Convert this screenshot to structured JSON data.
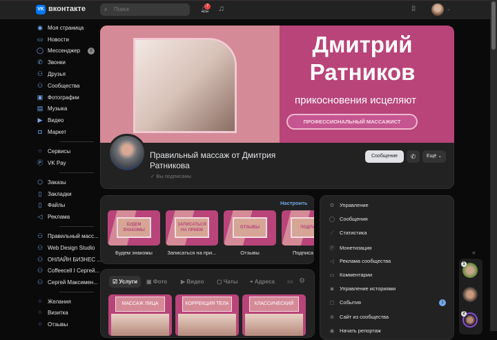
{
  "topbar": {
    "brand": "вконтакте",
    "logo": "VK",
    "search_placeholder": "Поиск",
    "notifications_count": "7"
  },
  "sidebar": {
    "items": [
      {
        "label": "Моя страница",
        "icon": "user-circle-icon"
      },
      {
        "label": "Новости",
        "icon": "news-icon"
      },
      {
        "label": "Мессенджер",
        "icon": "message-icon",
        "badge": "8"
      },
      {
        "label": "Звонки",
        "icon": "phone-icon"
      },
      {
        "label": "Друзья",
        "icon": "friends-icon"
      },
      {
        "label": "Сообщества",
        "icon": "communities-icon"
      },
      {
        "label": "Фотографии",
        "icon": "photo-icon"
      },
      {
        "label": "Музыка",
        "icon": "music-icon"
      },
      {
        "label": "Видео",
        "icon": "video-icon"
      },
      {
        "label": "Маркет",
        "icon": "bag-icon"
      },
      {
        "label": "Сервисы",
        "icon": "services-icon"
      },
      {
        "label": "VK Pay",
        "icon": "vkpay-icon"
      },
      {
        "label": "Заказы",
        "icon": "box-icon"
      },
      {
        "label": "Закладки",
        "icon": "bookmark-icon"
      },
      {
        "label": "Файлы",
        "icon": "file-icon"
      },
      {
        "label": "Реклама",
        "icon": "megaphone-icon"
      },
      {
        "label": "Правильный масс...",
        "icon": "group-icon"
      },
      {
        "label": "Web Design Studio",
        "icon": "group-icon"
      },
      {
        "label": "ОНЛАЙН БИЗНЕС ...",
        "icon": "group-icon"
      },
      {
        "label": "Coffeecell I Сергей...",
        "icon": "group-icon"
      },
      {
        "label": "Сергей Максимен...",
        "icon": "group-icon"
      },
      {
        "label": "Желания",
        "icon": "app-icon"
      },
      {
        "label": "Визитка",
        "icon": "app-icon"
      },
      {
        "label": "Отзывы",
        "icon": "app-icon"
      }
    ]
  },
  "cover": {
    "name_line1": "Дмитрий",
    "name_line2": "Ратников",
    "tagline": "прикосновения исцеляют",
    "badge": "ПРОФЕССИОНАЛЬНЫЙ МАССАЖИСТ"
  },
  "profile": {
    "title": "Правильный массаж от Дмитрия Ратникова",
    "subscribed": "Вы подписаны",
    "message_btn": "Сообщение",
    "more_btn": "Ещё"
  },
  "widgets": {
    "setup_link": "Настроить",
    "tiles": [
      {
        "inner": "БУДЕМ ЗНАКОМЫ",
        "caption": "Будем знакомы"
      },
      {
        "inner": "ЗАПИСАТЬСЯ НА ПРИЕМ",
        "caption": "Записаться на при..."
      },
      {
        "inner": "ОТЗЫВЫ",
        "caption": "Отзывы"
      },
      {
        "inner": "ПОДПИ",
        "caption": "Подписа"
      }
    ]
  },
  "services": {
    "tabs": [
      "Услуги",
      "Фото",
      "Видео",
      "Чаты",
      "Адреса"
    ],
    "tiles": [
      "МАССАЖ ЛИЦА",
      "КОРРЕКЦИЯ ТЕЛА",
      "КЛАССИЧЕСКИЙ"
    ]
  },
  "menu": {
    "items": [
      "Управление",
      "Сообщения",
      "Статистика",
      "Монетизация",
      "Реклама сообщества",
      "Комментарии",
      "Управление историями",
      "События",
      "Сайт из сообщества",
      "Начать репортаж"
    ],
    "events_badge": "1"
  },
  "stories": {
    "counts": [
      "1",
      "2"
    ]
  },
  "colors": {
    "accent": "#71aaeb",
    "brand_pink": "#b8447a",
    "bg": "#0a0a0a",
    "card": "#222222"
  }
}
